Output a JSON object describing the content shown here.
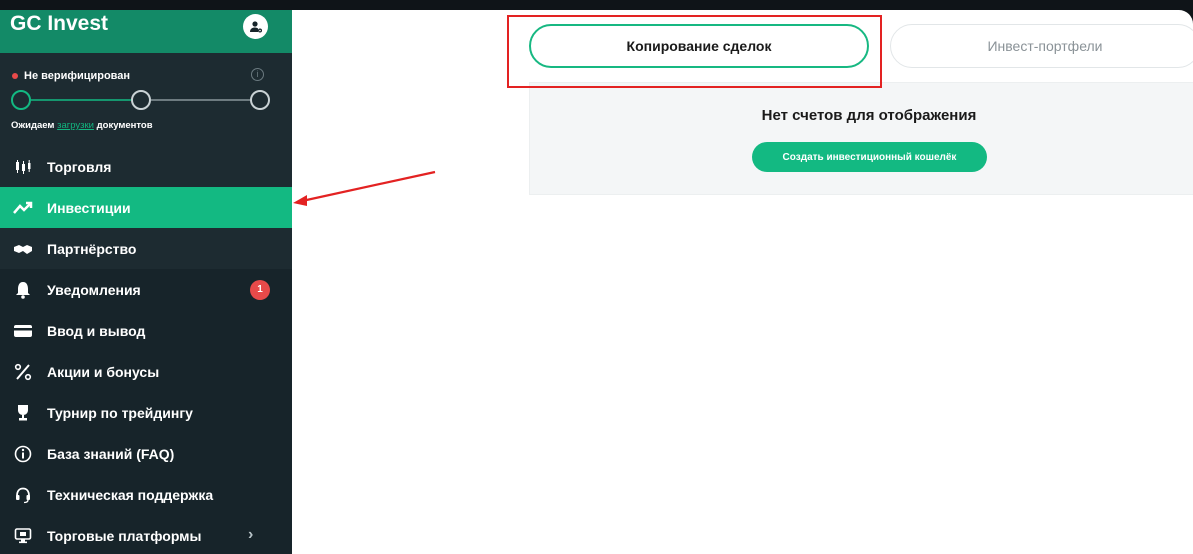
{
  "sidebar": {
    "brand": "GC Invest",
    "verification": {
      "status": "Не верифицирован",
      "note_prefix": "Ожидаем",
      "note_link": "загрузки",
      "note_suffix": "документов"
    },
    "items": [
      {
        "label": "Торговля",
        "icon": "candlestick-icon"
      },
      {
        "label": "Инвестиции",
        "icon": "trend-up-icon",
        "active": true
      },
      {
        "label": "Партнёрство",
        "icon": "handshake-icon"
      },
      {
        "label": "Уведомления",
        "icon": "bell-icon",
        "badge": "1"
      },
      {
        "label": "Ввод и вывод",
        "icon": "card-icon"
      },
      {
        "label": "Акции и бонусы",
        "icon": "percent-icon"
      },
      {
        "label": "Турнир по трейдингу",
        "icon": "trophy-icon"
      },
      {
        "label": "База знаний (FAQ)",
        "icon": "info-icon"
      },
      {
        "label": "Техническая поддержка",
        "icon": "headset-icon"
      },
      {
        "label": "Торговые платформы",
        "icon": "monitor-icon"
      }
    ]
  },
  "tabs": {
    "copy": "Копирование сделок",
    "invest": "Инвест-портфели"
  },
  "panel": {
    "title": "Нет счетов для отображения",
    "button": "Создать инвестиционный кошелёк"
  },
  "colors": {
    "accent": "#13b982",
    "sidebar_bg": "#17242a",
    "annotation": "#e32222"
  }
}
